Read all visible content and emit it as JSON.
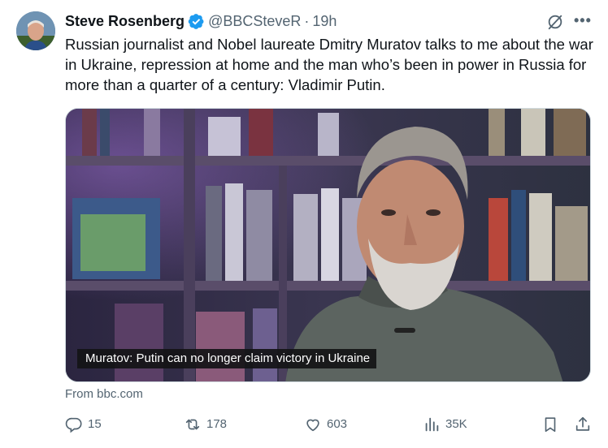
{
  "tweet": {
    "author_name": "Steve Rosenberg",
    "handle": "@BBCSteveR",
    "separator": "·",
    "time": "19h",
    "text": "Russian journalist and Nobel laureate Dmitry Muratov talks to me about the war in Ukraine, repression at home and the man who’s been in power in Russia for more than a quarter of a century: Vladimir Putin.",
    "media_caption": "Muratov: Putin can no longer claim victory in Ukraine",
    "source": "From bbc.com"
  },
  "actions": {
    "replies": "15",
    "reposts": "178",
    "likes": "603",
    "views": "35K"
  },
  "icons": [
    "verified-badge-icon",
    "grok-icon",
    "more-icon",
    "reply-icon",
    "repost-icon",
    "like-icon",
    "views-icon",
    "bookmark-icon",
    "share-icon"
  ],
  "colors": {
    "text": "#0f1419",
    "secondary": "#536471",
    "verified": "#1d9bf0"
  }
}
